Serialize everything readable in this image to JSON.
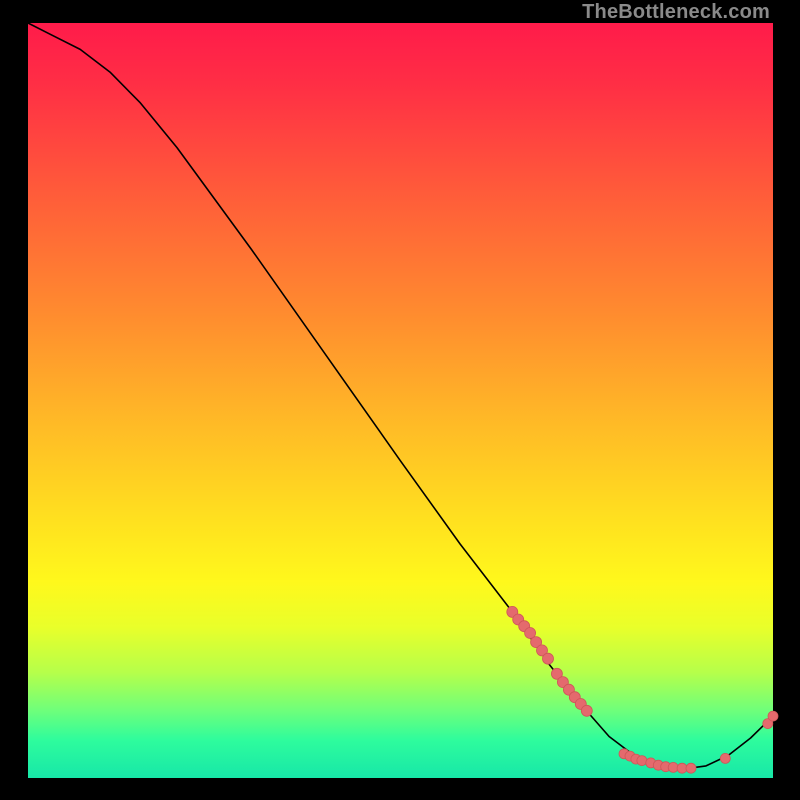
{
  "watermark": "TheBottleneck.com",
  "colors": {
    "curve": "#000000",
    "point_fill": "#e46a6d",
    "point_stroke": "#cf5659",
    "gradient_top": "#ff1b4a",
    "gradient_bottom": "#17e7a8"
  },
  "chart_data": {
    "type": "line",
    "title": "",
    "xlabel": "",
    "ylabel": "",
    "xlim": [
      0,
      100
    ],
    "ylim": [
      0,
      100
    ],
    "grid": false,
    "curve": [
      {
        "x": 0,
        "y": 100
      },
      {
        "x": 3,
        "y": 98.5
      },
      {
        "x": 7,
        "y": 96.5
      },
      {
        "x": 11,
        "y": 93.5
      },
      {
        "x": 15,
        "y": 89.5
      },
      {
        "x": 20,
        "y": 83.5
      },
      {
        "x": 30,
        "y": 70
      },
      {
        "x": 40,
        "y": 56
      },
      {
        "x": 50,
        "y": 42
      },
      {
        "x": 58,
        "y": 31
      },
      {
        "x": 65,
        "y": 22
      },
      {
        "x": 70,
        "y": 15
      },
      {
        "x": 74,
        "y": 10
      },
      {
        "x": 78,
        "y": 5.5
      },
      {
        "x": 82,
        "y": 2.5
      },
      {
        "x": 85,
        "y": 1.4
      },
      {
        "x": 88,
        "y": 1.2
      },
      {
        "x": 91,
        "y": 1.6
      },
      {
        "x": 94,
        "y": 3.0
      },
      {
        "x": 97,
        "y": 5.3
      },
      {
        "x": 100,
        "y": 8.2
      }
    ],
    "points_cluster_upper": [
      {
        "x": 65.0,
        "y": 22.0
      },
      {
        "x": 65.8,
        "y": 21.0
      },
      {
        "x": 66.6,
        "y": 20.1
      },
      {
        "x": 67.4,
        "y": 19.2
      },
      {
        "x": 68.2,
        "y": 18.0
      },
      {
        "x": 69.0,
        "y": 16.9
      },
      {
        "x": 69.8,
        "y": 15.8
      },
      {
        "x": 71.0,
        "y": 13.8
      },
      {
        "x": 71.8,
        "y": 12.7
      },
      {
        "x": 72.6,
        "y": 11.7
      },
      {
        "x": 73.4,
        "y": 10.7
      },
      {
        "x": 74.2,
        "y": 9.8
      },
      {
        "x": 75.0,
        "y": 8.9
      }
    ],
    "points_cluster_lower": [
      {
        "x": 80.0,
        "y": 3.2
      },
      {
        "x": 80.8,
        "y": 2.9
      },
      {
        "x": 81.6,
        "y": 2.5
      },
      {
        "x": 82.4,
        "y": 2.3
      },
      {
        "x": 83.6,
        "y": 2.0
      },
      {
        "x": 84.6,
        "y": 1.7
      },
      {
        "x": 85.6,
        "y": 1.5
      },
      {
        "x": 86.6,
        "y": 1.4
      },
      {
        "x": 87.8,
        "y": 1.3
      },
      {
        "x": 89.0,
        "y": 1.3
      },
      {
        "x": 93.6,
        "y": 2.6
      }
    ],
    "points_far_right": [
      {
        "x": 99.3,
        "y": 7.2
      },
      {
        "x": 100.0,
        "y": 8.2
      }
    ]
  }
}
